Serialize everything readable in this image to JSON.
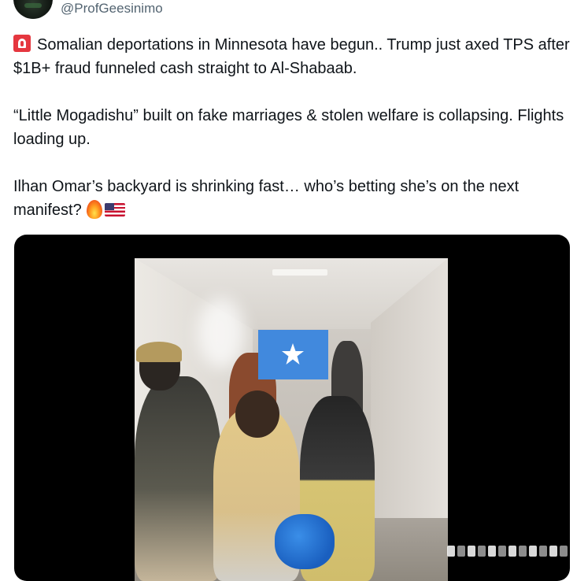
{
  "header": {
    "handle": "@ProfGeesinimo",
    "avatar_icon": "avatar-image"
  },
  "tweet": {
    "paragraph_1": "Somalian deportations in Minnesota have begun.. Trump just axed TPS after $1B+ fraud funneled cash straight to Al-Shabaab.",
    "paragraph_2": "“Little Mogadishu” built on fake marriages & stolen welfare is collapsing. Flights loading up.",
    "paragraph_3": "Ilhan Omar’s backyard is shrinking fast… who’s betting she’s on the next manifest?",
    "icons": {
      "lead": "rotating-light-icon",
      "trail": [
        "fire-icon",
        "us-flag-icon"
      ]
    }
  },
  "media": {
    "type": "video",
    "overlay_icon": "somalia-flag-icon",
    "colors": {
      "somalia_flag_blue": "#4189dd",
      "background": "#000000"
    }
  }
}
